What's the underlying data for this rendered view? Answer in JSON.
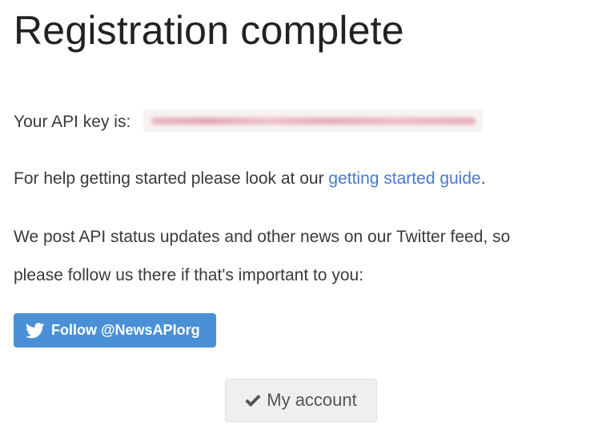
{
  "page": {
    "title": "Registration complete"
  },
  "api_key": {
    "label": "Your API key is:",
    "value_state": "blurred"
  },
  "help": {
    "prefix": "For help getting started please look at our ",
    "link_text": "getting started guide",
    "suffix": "."
  },
  "news": {
    "line1": "We post API status updates and other news on our Twitter feed, so",
    "line2": "please follow us there if that's important to you:"
  },
  "twitter_button": {
    "label": "Follow @NewsAPIorg",
    "icon": "twitter-bird-icon",
    "color": "#4a90d6"
  },
  "account_button": {
    "label": "My account",
    "icon": "check-icon"
  },
  "colors": {
    "link": "#4a78d0",
    "text": "#3a3a3a",
    "title": "#222222"
  }
}
